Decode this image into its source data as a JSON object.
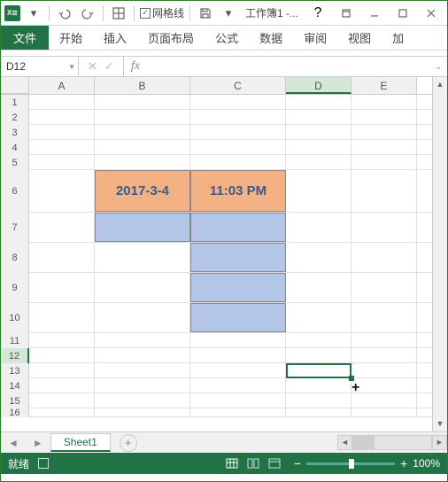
{
  "titlebar": {
    "gridlines_label": "网格线",
    "gridlines_checked": true,
    "doc_title": "工作簿1 -..."
  },
  "ribbon": {
    "file": "文件",
    "tabs": [
      "开始",
      "插入",
      "页面布局",
      "公式",
      "数据",
      "审阅",
      "视图",
      "加"
    ]
  },
  "formula": {
    "namebox": "D12",
    "fx": "fx"
  },
  "columns": [
    "A",
    "B",
    "C",
    "D",
    "E"
  ],
  "rows": [
    "1",
    "2",
    "3",
    "4",
    "5",
    "6",
    "7",
    "8",
    "9",
    "10",
    "11",
    "12",
    "13",
    "14",
    "15",
    "16"
  ],
  "cells": {
    "B6": "2017-3-4",
    "C6": "11:03 PM"
  },
  "active_cell": "D12",
  "sheets": {
    "active": "Sheet1"
  },
  "status": {
    "ready": "就绪",
    "zoom": "100%"
  }
}
